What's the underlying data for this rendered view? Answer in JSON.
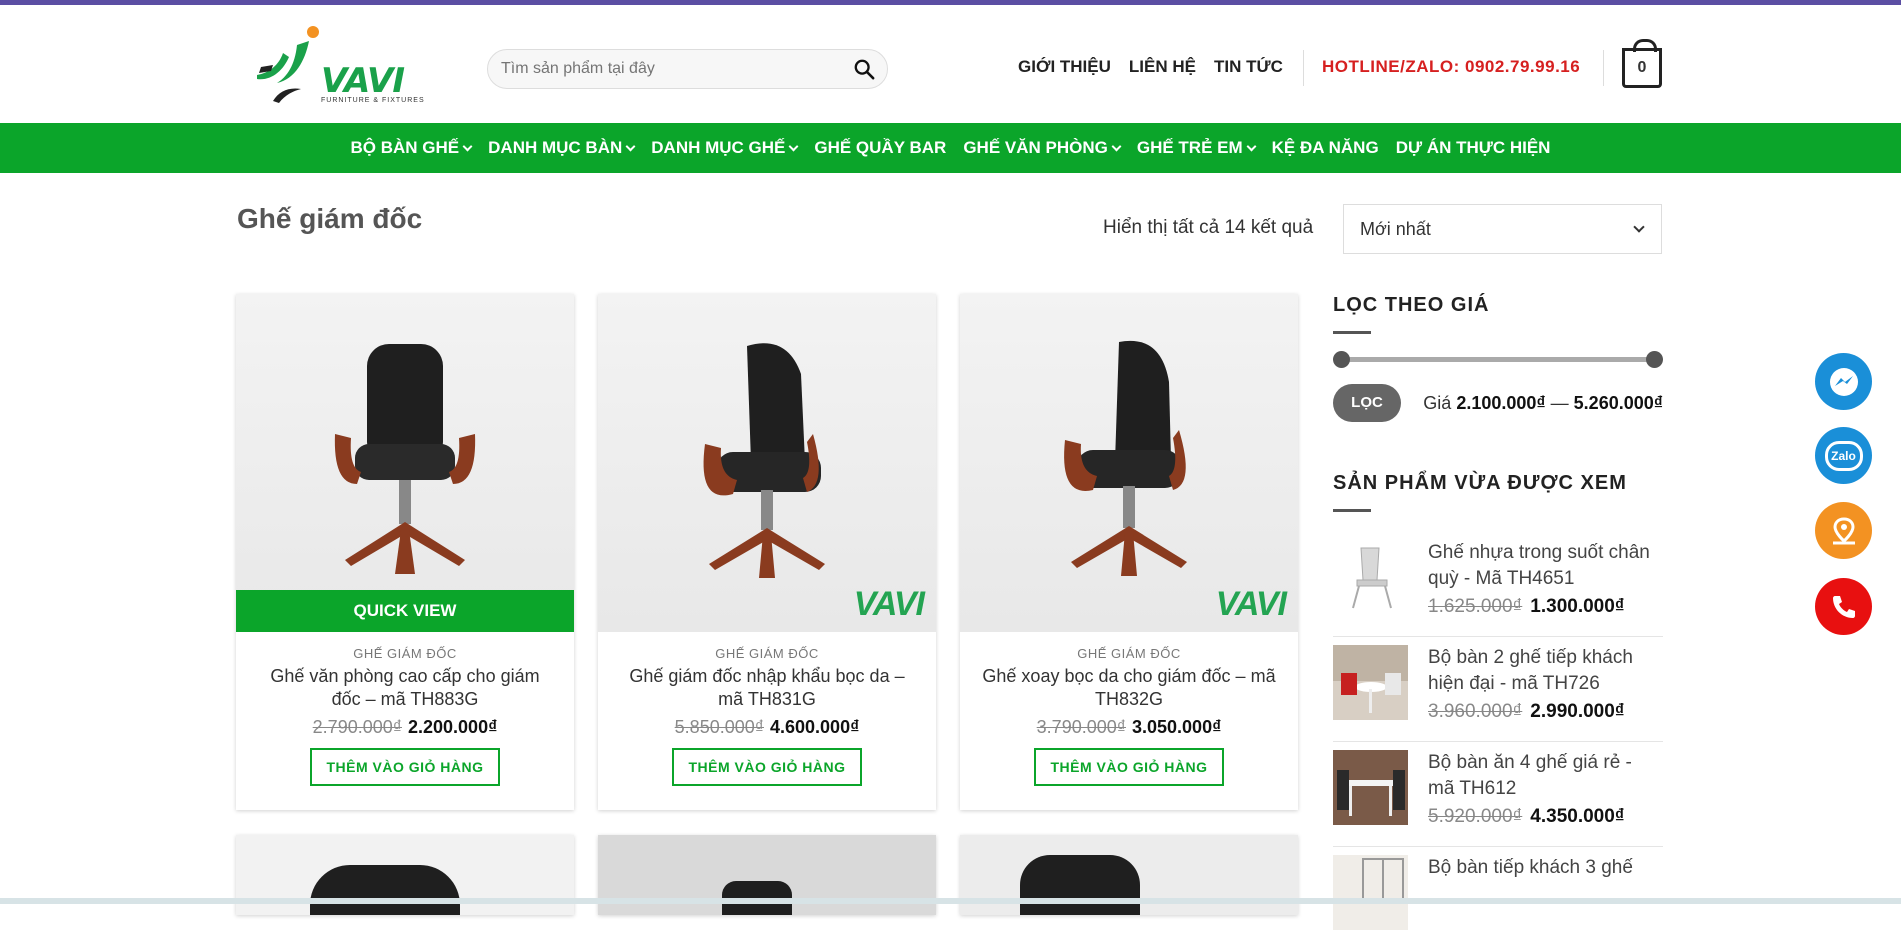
{
  "header": {
    "logo_brand": "VAVI",
    "logo_tagline": "FURNITURE & FIXTURES",
    "search_placeholder": "Tìm sản phẩm tại đây",
    "top_links": [
      "GIỚI THIỆU",
      "LIÊN HỆ",
      "TIN TỨC"
    ],
    "hotline": "HOTLINE/ZALO: 0902.79.99.16",
    "cart_count": "0"
  },
  "nav": {
    "items": [
      {
        "label": "BỘ BÀN GHẾ",
        "dropdown": true
      },
      {
        "label": "DANH MỤC BÀN",
        "dropdown": true
      },
      {
        "label": "DANH MỤC GHẾ",
        "dropdown": true
      },
      {
        "label": "GHẾ QUẦY BAR",
        "dropdown": false
      },
      {
        "label": "GHẾ VĂN PHÒNG",
        "dropdown": true
      },
      {
        "label": "GHẾ TRẺ EM",
        "dropdown": true
      },
      {
        "label": "KỆ ĐA NĂNG",
        "dropdown": false
      },
      {
        "label": "DỰ ÁN THỰC HIỆN",
        "dropdown": false
      }
    ]
  },
  "page": {
    "title": "Ghế giám đốc",
    "result_count": "Hiển thị tất cả 14 kết quả",
    "sort_selected": "Mới nhất"
  },
  "products": [
    {
      "category": "GHẾ GIÁM ĐỐC",
      "name": "Ghế văn phòng cao cấp cho giám đốc – mã TH883G",
      "old_price": "2.790.000₫",
      "price": "2.200.000₫",
      "button": "THÊM VÀO GIỎ HÀNG",
      "quick_view": "QUICK VIEW"
    },
    {
      "category": "GHẾ GIÁM ĐỐC",
      "name": "Ghế giám đốc nhập khẩu bọc da – mã TH831G",
      "old_price": "5.850.000₫",
      "price": "4.600.000₫",
      "button": "THÊM VÀO GIỎ HÀNG"
    },
    {
      "category": "GHẾ GIÁM ĐỐC",
      "name": "Ghế xoay bọc da cho giám đốc – mã TH832G",
      "old_price": "3.790.000₫",
      "price": "3.050.000₫",
      "button": "THÊM VÀO GIỎ HÀNG"
    }
  ],
  "sidebar": {
    "price_filter_title": "LỌC THEO GIÁ",
    "filter_button": "LỌC",
    "price_label": "Giá",
    "price_min": "2.100.000₫",
    "price_sep": "—",
    "price_max": "5.260.000₫",
    "recent_title": "SẢN PHẨM VỪA ĐƯỢC XEM",
    "recent": [
      {
        "name": "Ghế nhựa trong suốt chân quỳ - Mã TH4651",
        "old_price": "1.625.000₫",
        "price": "1.300.000₫"
      },
      {
        "name": "Bộ bàn 2 ghế tiếp khách hiện đại - mã TH726",
        "old_price": "3.960.000₫",
        "price": "2.990.000₫"
      },
      {
        "name": "Bộ bàn ăn 4 ghế giá rẻ - mã TH612",
        "old_price": "5.920.000₫",
        "price": "4.350.000₫"
      },
      {
        "name": "Bộ bàn tiếp khách 3 ghế",
        "old_price": "",
        "price": ""
      }
    ]
  },
  "floating": {
    "zalo_label": "Zalo"
  },
  "colors": {
    "brand_green": "#0ba52a",
    "hotline_red": "#d62020",
    "messenger_blue": "#1a8fd8",
    "map_orange": "#f39222",
    "phone_red": "#e81010"
  }
}
